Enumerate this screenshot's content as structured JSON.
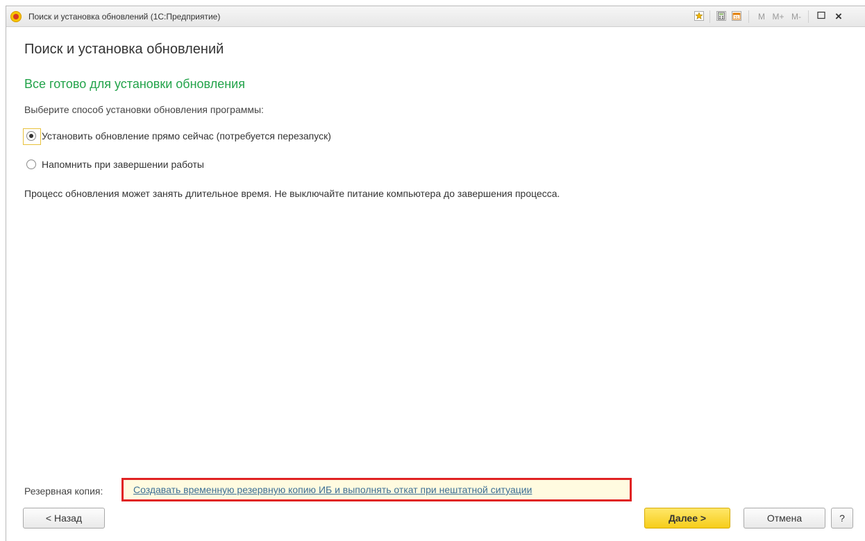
{
  "window": {
    "title": "Поиск и установка обновлений  (1С:Предприятие)",
    "toolbar": {
      "m": "M",
      "m_plus": "M+",
      "m_minus": "M-",
      "close": "×"
    }
  },
  "page": {
    "title": "Поиск и установка обновлений",
    "subtitle": "Все готово для установки обновления",
    "prompt": "Выберите способ установки обновления программы:",
    "options": [
      {
        "label": "Установить обновление прямо сейчас (потребуется перезапуск)",
        "selected": true
      },
      {
        "label": "Напомнить при завершении работы",
        "selected": false
      }
    ],
    "note": "Процесс обновления может занять длительное время. Не выключайте питание компьютера до завершения процесса."
  },
  "backup": {
    "label": "Резервная копия:",
    "link": "Создавать временную резервную копию ИБ и выполнять откат при нештатной ситуации"
  },
  "buttons": {
    "back": "< Назад",
    "next": "Далее >",
    "cancel": "Отмена",
    "help": "?"
  },
  "colors": {
    "subtitle": "#22a34a",
    "highlight_border": "#e02222",
    "primary_button": "#f6cd1a",
    "link": "#3c6f95"
  },
  "icons": [
    "1c-app-icon",
    "favorites-icon",
    "calculator-icon",
    "calendar-icon",
    "maximize-icon",
    "close-icon"
  ]
}
